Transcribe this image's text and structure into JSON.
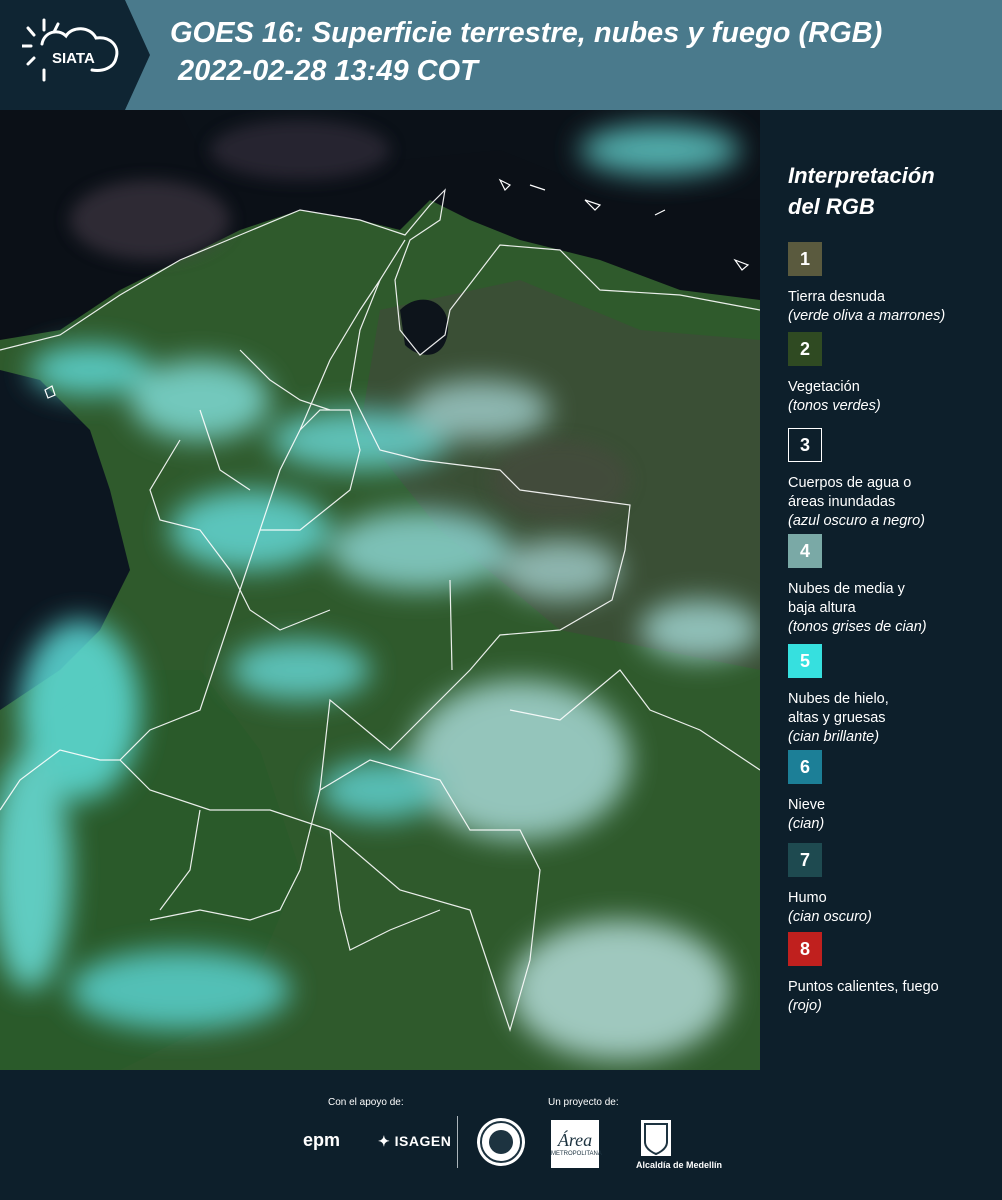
{
  "header": {
    "logo_text": "SIATA",
    "title_line1": "GOES 16: Superficie terrestre, nubes y fuego (RGB)",
    "title_line2": "2022-02-28 13:49 COT"
  },
  "legend": {
    "title_line1": "Interpretación",
    "title_line2": "del RGB",
    "items": [
      {
        "num": "1",
        "color": "#5a5a3e",
        "label": [
          "Tierra desnuda"
        ],
        "sub": "(verde oliva a marrones)"
      },
      {
        "num": "2",
        "color": "#2f4a22",
        "label": [
          "Vegetación"
        ],
        "sub": "(tonos verdes)"
      },
      {
        "num": "3",
        "color": "#0d1f2b",
        "label": [
          "Cuerpos de agua o",
          "áreas inundadas"
        ],
        "sub": "(azul oscuro a negro)"
      },
      {
        "num": "4",
        "color": "#7aa9a6",
        "label": [
          "Nubes de media y",
          "baja altura"
        ],
        "sub": "(tonos grises de cian)"
      },
      {
        "num": "5",
        "color": "#36e0df",
        "label": [
          "Nubes de hielo,",
          "altas y gruesas"
        ],
        "sub": "(cian brillante)"
      },
      {
        "num": "6",
        "color": "#1c7f97",
        "label": [
          "Nieve"
        ],
        "sub": "(cian)"
      },
      {
        "num": "7",
        "color": "#1e4a50",
        "label": [
          "Humo"
        ],
        "sub": "(cian oscuro)"
      },
      {
        "num": "8",
        "color": "#c0201e",
        "label": [
          "Puntos calientes, fuego"
        ],
        "sub": "(rojo)"
      }
    ]
  },
  "footer": {
    "support_label": "Con el apoyo de:",
    "project_label": "Un proyecto de:",
    "epm": "epm",
    "isagen": "ISAGEN",
    "amva_text": "Área",
    "amva_sub": "METROPOLITANA",
    "alcaldia": "Alcaldía de Medellín"
  }
}
